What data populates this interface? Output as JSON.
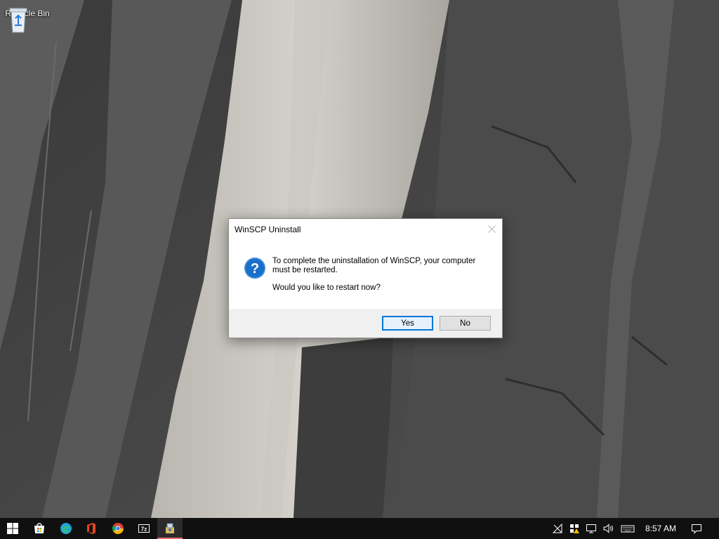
{
  "desktop": {
    "icons": [
      {
        "label": "Recycle Bin",
        "icon": "recycle-bin-icon"
      }
    ]
  },
  "dialog": {
    "title": "WinSCP Uninstall",
    "message": "To complete the uninstallation of WinSCP, your computer must be restarted.",
    "question": "Would you like to restart now?",
    "icon": "question-icon",
    "buttons": {
      "yes": "Yes",
      "no": "No"
    },
    "accent": "#0078d7"
  },
  "taskbar": {
    "pinned": [
      "windows-start-icon",
      "store-icon",
      "edge-icon",
      "office-icon",
      "chrome-icon",
      "7zip-icon",
      "winscp-installer-icon"
    ],
    "tray_icons": [
      "network-disconnected-icon",
      "security-warning-icon",
      "display-icon",
      "volume-icon",
      "keyboard-icon"
    ],
    "clock": "8:57 AM",
    "notification_icon": "action-center-icon"
  }
}
